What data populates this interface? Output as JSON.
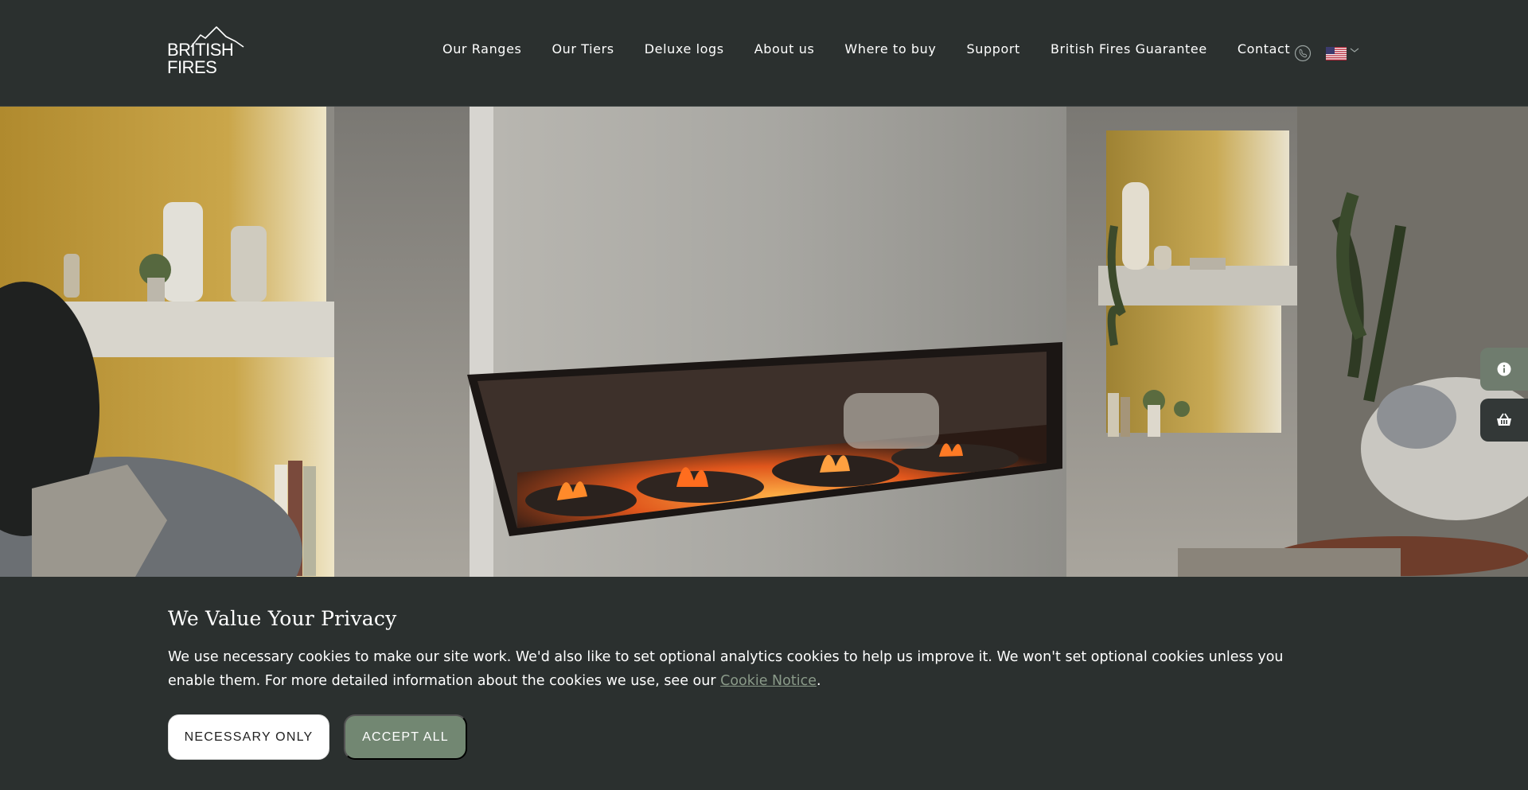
{
  "header": {
    "logo_text_line1": "BRITISH",
    "logo_text_line2": "FIRES",
    "nav": [
      {
        "label": "Our Ranges"
      },
      {
        "label": "Our Tiers"
      },
      {
        "label": "Deluxe logs"
      },
      {
        "label": "About us"
      },
      {
        "label": "Where to buy"
      },
      {
        "label": "Support"
      },
      {
        "label": "British Fires Guarantee"
      },
      {
        "label": "Contact"
      }
    ],
    "icons": {
      "phone": "phone-icon",
      "flag": "us-flag-icon",
      "chevron": "chevron-down-icon"
    }
  },
  "side_widgets": {
    "info_icon": "info-icon",
    "basket_icon": "basket-icon"
  },
  "cookie": {
    "title": "We Value Your Privacy",
    "text_before_link": "We use necessary cookies to make our site work. We'd also like to set optional analytics cookies to help us improve it. We won't set optional cookies unless you enable them. For more detailed information about the cookies we use, see our ",
    "link_label": "Cookie Notice",
    "text_after_link": ".",
    "necessary_label": "NECESSARY ONLY",
    "accept_label": "ACCEPT ALL"
  },
  "colors": {
    "header_bg": "#2b302f",
    "accent_green": "#728772",
    "link_muted": "#8a9a89"
  }
}
